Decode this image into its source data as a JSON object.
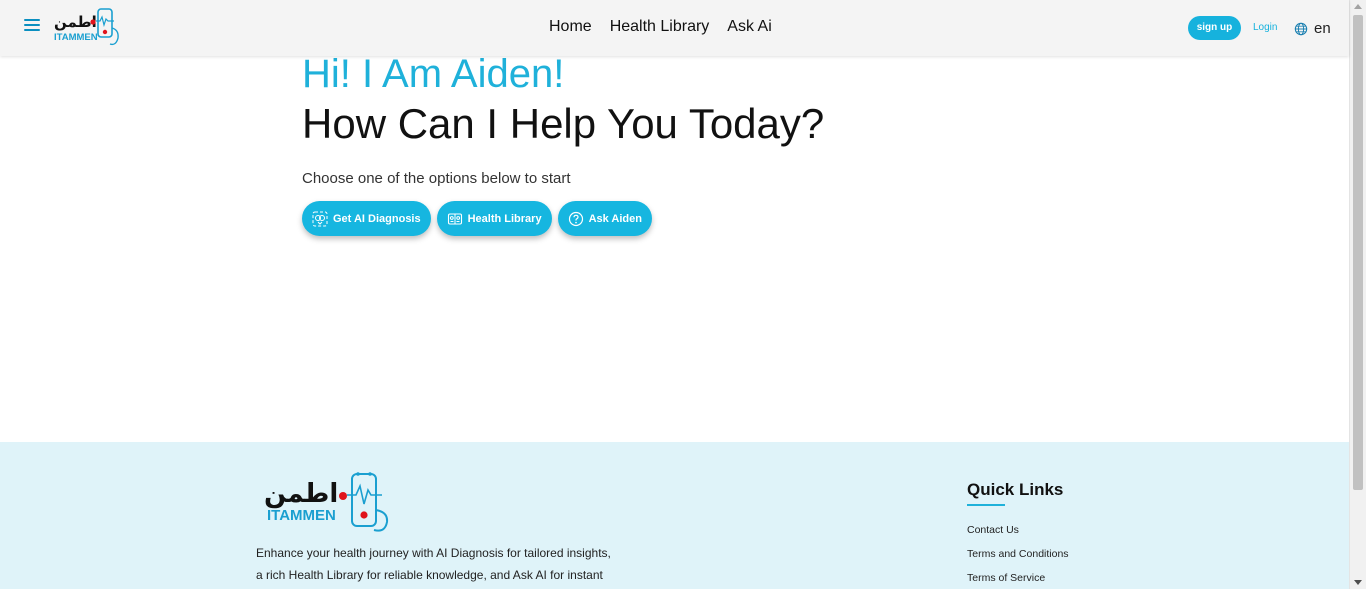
{
  "header": {
    "logo_arabic": "اطمن",
    "logo_text": "ITAMMEN",
    "nav": [
      "Home",
      "Health Library",
      "Ask Ai"
    ],
    "signup_label": "sign up",
    "login_label": "Login",
    "lang_label": "en"
  },
  "hero": {
    "greeting": "Hi! I Am Aiden!",
    "headline": "How Can I Help You Today?",
    "subtitle": "Choose one of the options below to start",
    "actions": [
      {
        "label": "Get AI Diagnosis",
        "icon": "brain-scan-icon"
      },
      {
        "label": "Health Library",
        "icon": "library-icon"
      },
      {
        "label": "Ask Aiden",
        "icon": "question-icon"
      }
    ]
  },
  "footer": {
    "logo_arabic": "اطمن",
    "logo_text": "ITAMMEN",
    "description_line1": "Enhance your health journey with AI Diagnosis for tailored insights,",
    "description_line2": "a rich Health Library for reliable knowledge, and Ask AI for instant",
    "quick_links_title": "Quick Links",
    "quick_links": [
      "Contact Us",
      "Terms and Conditions",
      "Terms of Service"
    ]
  },
  "colors": {
    "accent": "#1fb1da",
    "button": "#16b6e0",
    "footer_bg": "#dff3f9",
    "header_bg": "#f4f4f4",
    "logo_dot": "#e0141c"
  }
}
